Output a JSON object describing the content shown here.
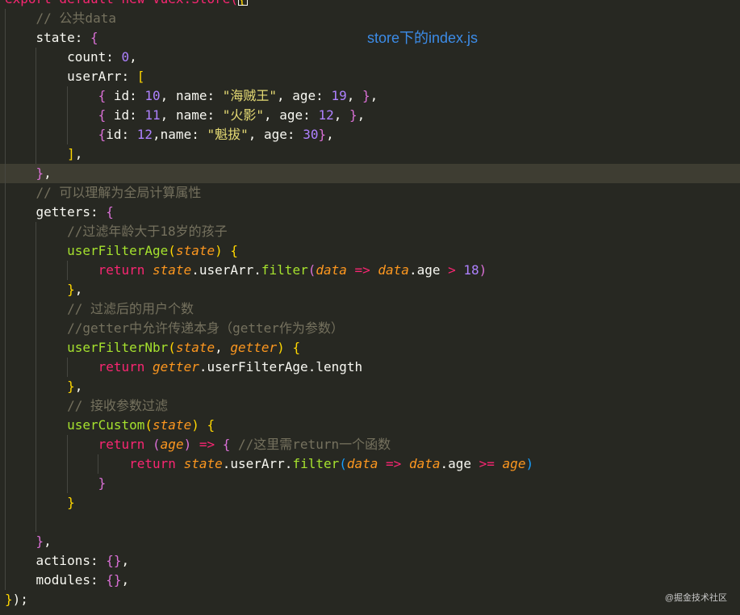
{
  "editor": {
    "theme": "monokai",
    "current_line_number": 9,
    "lines": [
      [
        {
          "t": "export default new Vuex.Store(",
          "c": "tok-kw"
        },
        {
          "t": "{",
          "c": "b1"
        }
      ],
      [
        {
          "t": "    // 公共data",
          "c": "tok-comment"
        }
      ],
      [
        {
          "t": "    state: ",
          "c": "tok-plain"
        },
        {
          "t": "{",
          "c": "b2"
        }
      ],
      [
        {
          "t": "        count: ",
          "c": "tok-plain"
        },
        {
          "t": "0",
          "c": "tok-num"
        },
        {
          "t": ",",
          "c": "tok-plain"
        }
      ],
      [
        {
          "t": "        userArr: ",
          "c": "tok-plain"
        },
        {
          "t": "[",
          "c": "b1"
        }
      ],
      [
        {
          "t": "            ",
          "c": "tok-plain"
        },
        {
          "t": "{",
          "c": "b2"
        },
        {
          "t": " id: ",
          "c": "tok-plain"
        },
        {
          "t": "10",
          "c": "tok-num"
        },
        {
          "t": ", name: ",
          "c": "tok-plain"
        },
        {
          "t": "\"海贼王\"",
          "c": "tok-str"
        },
        {
          "t": ", age: ",
          "c": "tok-plain"
        },
        {
          "t": "19",
          "c": "tok-num"
        },
        {
          "t": ", ",
          "c": "tok-plain"
        },
        {
          "t": "}",
          "c": "b2"
        },
        {
          "t": ",",
          "c": "tok-plain"
        }
      ],
      [
        {
          "t": "            ",
          "c": "tok-plain"
        },
        {
          "t": "{",
          "c": "b2"
        },
        {
          "t": " id: ",
          "c": "tok-plain"
        },
        {
          "t": "11",
          "c": "tok-num"
        },
        {
          "t": ", name: ",
          "c": "tok-plain"
        },
        {
          "t": "\"火影\"",
          "c": "tok-str"
        },
        {
          "t": ", age: ",
          "c": "tok-plain"
        },
        {
          "t": "12",
          "c": "tok-num"
        },
        {
          "t": ", ",
          "c": "tok-plain"
        },
        {
          "t": "}",
          "c": "b2"
        },
        {
          "t": ",",
          "c": "tok-plain"
        }
      ],
      [
        {
          "t": "            ",
          "c": "tok-plain"
        },
        {
          "t": "{",
          "c": "b2"
        },
        {
          "t": "id: ",
          "c": "tok-plain"
        },
        {
          "t": "12",
          "c": "tok-num"
        },
        {
          "t": ",name: ",
          "c": "tok-plain"
        },
        {
          "t": "\"魁拔\"",
          "c": "tok-str"
        },
        {
          "t": ", age: ",
          "c": "tok-plain"
        },
        {
          "t": "30",
          "c": "tok-num"
        },
        {
          "t": "}",
          "c": "b2"
        },
        {
          "t": ",",
          "c": "tok-plain"
        }
      ],
      [
        {
          "t": "        ",
          "c": "tok-plain"
        },
        {
          "t": "]",
          "c": "b1"
        },
        {
          "t": ",",
          "c": "tok-plain"
        }
      ],
      [
        {
          "t": "    ",
          "c": "tok-plain"
        },
        {
          "t": "}",
          "c": "b2"
        },
        {
          "t": ",",
          "c": "tok-plain"
        }
      ],
      [
        {
          "t": "    // 可以理解为全局计算属性",
          "c": "tok-comment"
        }
      ],
      [
        {
          "t": "    getters: ",
          "c": "tok-plain"
        },
        {
          "t": "{",
          "c": "b2"
        }
      ],
      [
        {
          "t": "        //过滤年龄大于18岁的孩子",
          "c": "tok-comment"
        }
      ],
      [
        {
          "t": "        ",
          "c": "tok-plain"
        },
        {
          "t": "userFilterAge",
          "c": "tok-fn"
        },
        {
          "t": "(",
          "c": "b1"
        },
        {
          "t": "state",
          "c": "tok-param"
        },
        {
          "t": ") ",
          "c": "b1"
        },
        {
          "t": "{",
          "c": "b1"
        }
      ],
      [
        {
          "t": "            ",
          "c": "tok-plain"
        },
        {
          "t": "return ",
          "c": "tok-kw"
        },
        {
          "t": "state",
          "c": "tok-param"
        },
        {
          "t": ".userArr.",
          "c": "tok-plain"
        },
        {
          "t": "filter",
          "c": "tok-fn"
        },
        {
          "t": "(",
          "c": "b2"
        },
        {
          "t": "data",
          "c": "tok-param"
        },
        {
          "t": " => ",
          "c": "tok-op"
        },
        {
          "t": "data",
          "c": "tok-param"
        },
        {
          "t": ".age ",
          "c": "tok-plain"
        },
        {
          "t": ">",
          "c": "tok-op"
        },
        {
          "t": " 18",
          "c": "tok-num"
        },
        {
          "t": ")",
          "c": "b2"
        }
      ],
      [
        {
          "t": "        ",
          "c": "tok-plain"
        },
        {
          "t": "}",
          "c": "b1"
        },
        {
          "t": ",",
          "c": "tok-plain"
        }
      ],
      [
        {
          "t": "        // 过滤后的用户个数",
          "c": "tok-comment"
        }
      ],
      [
        {
          "t": "        //getter中允许传递本身（getter作为参数）",
          "c": "tok-comment"
        }
      ],
      [
        {
          "t": "        ",
          "c": "tok-plain"
        },
        {
          "t": "userFilterNbr",
          "c": "tok-fn"
        },
        {
          "t": "(",
          "c": "b1"
        },
        {
          "t": "state",
          "c": "tok-param"
        },
        {
          "t": ", ",
          "c": "tok-plain"
        },
        {
          "t": "getter",
          "c": "tok-param"
        },
        {
          "t": ") ",
          "c": "b1"
        },
        {
          "t": "{",
          "c": "b1"
        }
      ],
      [
        {
          "t": "            ",
          "c": "tok-plain"
        },
        {
          "t": "return ",
          "c": "tok-kw"
        },
        {
          "t": "getter",
          "c": "tok-param"
        },
        {
          "t": ".userFilterAge.length",
          "c": "tok-plain"
        }
      ],
      [
        {
          "t": "        ",
          "c": "tok-plain"
        },
        {
          "t": "}",
          "c": "b1"
        },
        {
          "t": ",",
          "c": "tok-plain"
        }
      ],
      [
        {
          "t": "        // 接收参数过滤",
          "c": "tok-comment"
        }
      ],
      [
        {
          "t": "        ",
          "c": "tok-plain"
        },
        {
          "t": "userCustom",
          "c": "tok-fn"
        },
        {
          "t": "(",
          "c": "b1"
        },
        {
          "t": "state",
          "c": "tok-param"
        },
        {
          "t": ") ",
          "c": "b1"
        },
        {
          "t": "{",
          "c": "b1"
        }
      ],
      [
        {
          "t": "            ",
          "c": "tok-plain"
        },
        {
          "t": "return ",
          "c": "tok-kw"
        },
        {
          "t": "(",
          "c": "b2"
        },
        {
          "t": "age",
          "c": "tok-param"
        },
        {
          "t": ")",
          "c": "b2"
        },
        {
          "t": " => ",
          "c": "tok-op"
        },
        {
          "t": "{",
          "c": "b2"
        },
        {
          "t": " //这里需return一个函数",
          "c": "tok-comment"
        }
      ],
      [
        {
          "t": "                ",
          "c": "tok-plain"
        },
        {
          "t": "return ",
          "c": "tok-kw"
        },
        {
          "t": "state",
          "c": "tok-param"
        },
        {
          "t": ".userArr.",
          "c": "tok-plain"
        },
        {
          "t": "filter",
          "c": "tok-fn"
        },
        {
          "t": "(",
          "c": "b3"
        },
        {
          "t": "data",
          "c": "tok-param"
        },
        {
          "t": " => ",
          "c": "tok-op"
        },
        {
          "t": "data",
          "c": "tok-param"
        },
        {
          "t": ".age ",
          "c": "tok-plain"
        },
        {
          "t": ">=",
          "c": "tok-op"
        },
        {
          "t": " ",
          "c": "tok-plain"
        },
        {
          "t": "age",
          "c": "tok-param"
        },
        {
          "t": ")",
          "c": "b3"
        }
      ],
      [
        {
          "t": "            ",
          "c": "tok-plain"
        },
        {
          "t": "}",
          "c": "b2"
        }
      ],
      [
        {
          "t": "        ",
          "c": "tok-plain"
        },
        {
          "t": "}",
          "c": "b1"
        }
      ],
      [
        {
          "t": "",
          "c": "tok-plain"
        }
      ],
      [
        {
          "t": "    ",
          "c": "tok-plain"
        },
        {
          "t": "}",
          "c": "b2"
        },
        {
          "t": ",",
          "c": "tok-plain"
        }
      ],
      [
        {
          "t": "    actions: ",
          "c": "tok-plain"
        },
        {
          "t": "{}",
          "c": "b2"
        },
        {
          "t": ",",
          "c": "tok-plain"
        }
      ],
      [
        {
          "t": "    modules: ",
          "c": "tok-plain"
        },
        {
          "t": "{}",
          "c": "b2"
        },
        {
          "t": ",",
          "c": "tok-plain"
        }
      ],
      [
        {
          "t": "}",
          "c": "b1"
        },
        {
          "t": ")",
          "c": "tok-plain"
        },
        {
          "t": ";",
          "c": "tok-plain"
        }
      ]
    ]
  },
  "annotation": {
    "text": "store下的index.js",
    "color": "#3c8ce8"
  },
  "watermark": {
    "text": "@掘金技术社区"
  },
  "colors": {
    "background": "#272822",
    "current_line": "#3e3d32",
    "keyword": "#f92672",
    "number": "#ae81ff",
    "string": "#e6db74",
    "function": "#a6e22e",
    "parameter": "#fd971f",
    "comment": "#75715e"
  }
}
